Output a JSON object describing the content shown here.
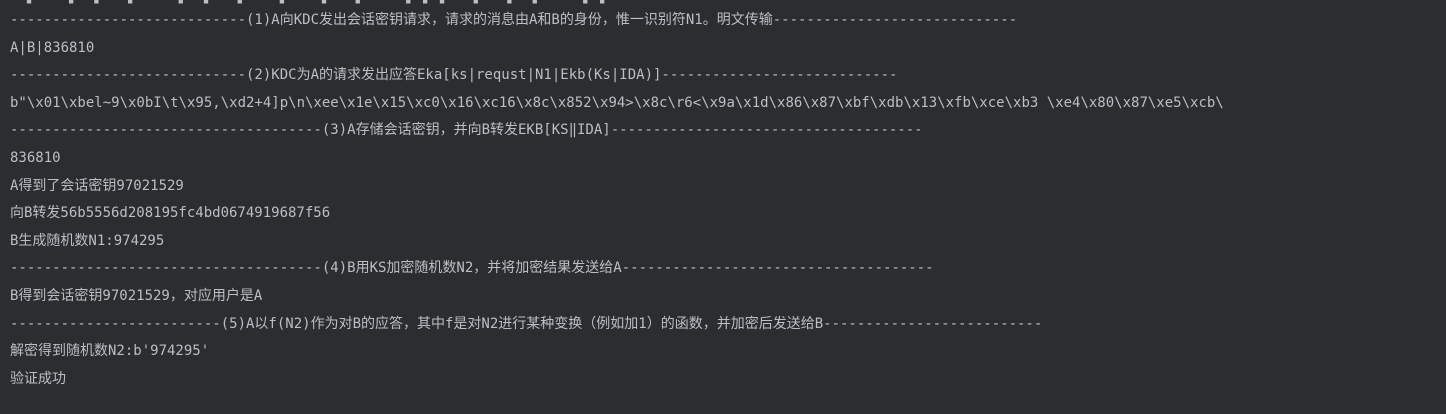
{
  "console": {
    "lines": [
      "----------------------------(1)A向KDC发出会话密钥请求，请求的消息由A和B的身份，惟一识别符N1。明文传输-----------------------------",
      "A|B|836810",
      "----------------------------(2)KDC为A的请求发出应答Eka[ks|requst|N1|Ekb(Ks|IDA)]----------------------------",
      "b\"\\x01\\xbel~9\\x0bI\\t\\x95,\\xd2+4]p\\n\\xee\\x1e\\x15\\xc0\\x16\\xc16\\x8c\\x852\\x94>\\x8c\\r6<\\x9a\\x1d\\x86\\x87\\xbf\\xdb\\x13\\xfb\\xce\\xb3 \\xe4\\x80\\x87\\xe5\\xcb\\",
      "-------------------------------------(3)A存储会话密钥，并向B转发EKB[KS‖IDA]-------------------------------------",
      "836810",
      "A得到了会话密钥97021529",
      "向B转发56b5556d208195fc4bd0674919687f56",
      "B生成随机数N1:974295",
      "-------------------------------------(4)B用KS加密随机数N2，并将加密结果发送给A-------------------------------------",
      "B得到会话密钥97021529，对应用户是A",
      "-------------------------(5)A以f(N2)作为对B的应答，其中f是对N2进行某种变换（例如加1）的函数，并加密后发送给B--------------------------",
      "解密得到随机数N2:b'974295'",
      "验证成功"
    ]
  },
  "colors": {
    "background": "#2b2d30",
    "text": "#bcbec4"
  }
}
